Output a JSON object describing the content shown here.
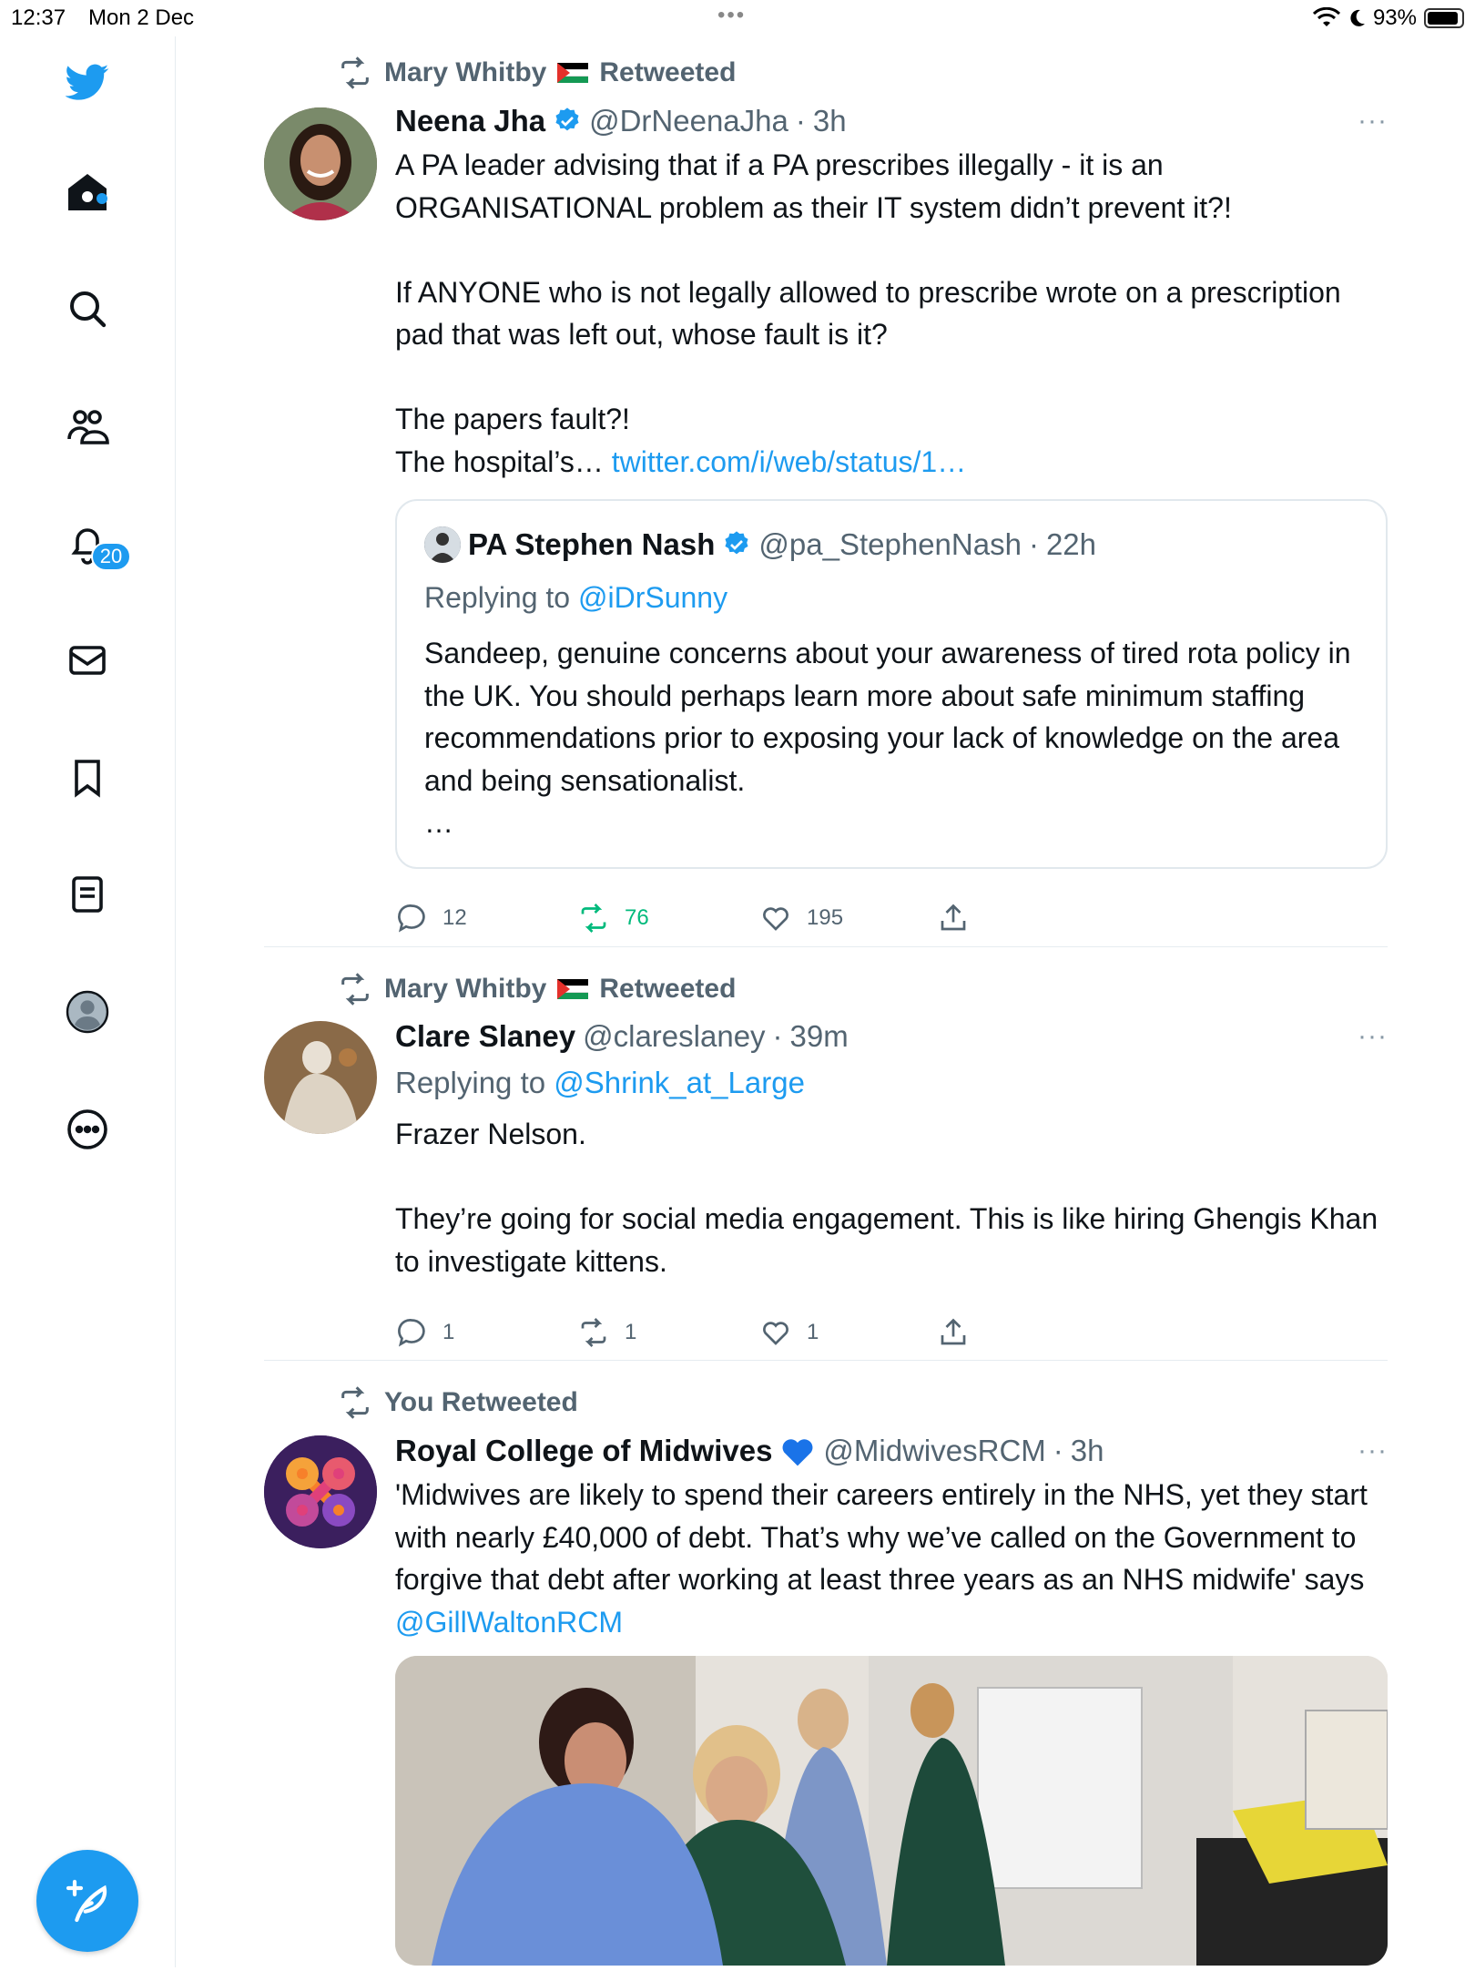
{
  "status_bar": {
    "time": "12:37",
    "date": "Mon 2 Dec",
    "battery": "93%",
    "battery_level": 0.93
  },
  "sidebar": {
    "items": [
      {
        "name": "home"
      },
      {
        "name": "explore"
      },
      {
        "name": "communities"
      },
      {
        "name": "notifications",
        "badge": "20"
      },
      {
        "name": "messages"
      },
      {
        "name": "bookmarks"
      },
      {
        "name": "lists"
      },
      {
        "name": "profile"
      },
      {
        "name": "more"
      }
    ],
    "accent": "#1d9bf0"
  },
  "tweets": [
    {
      "retweeted_by": "Mary Whitby",
      "retweet_label": "Retweeted",
      "name": "Neena Jha",
      "verified": true,
      "handle": "@DrNeenaJha",
      "time": "3h",
      "text": "A PA leader advising that if a PA prescribes illegally - it is an ORGANISATIONAL problem as their IT system didn’t prevent it?!\n\nIf ANYONE who is not legally allowed to prescribe wrote on a prescription pad that was left out, whose fault is it?\n\nThe papers fault?!\nThe hospital’s… ",
      "link": "twitter.com/i/web/status/1…",
      "quote": {
        "name": "PA Stephen Nash",
        "verified": true,
        "handle": "@pa_StephenNash",
        "time": "22h",
        "replying_prefix": "Replying to ",
        "replying_to": "@iDrSunny",
        "text": "Sandeep, genuine concerns about your awareness of tired rota policy in the UK. You should perhaps learn more about safe minimum staffing recommendations prior to exposing your lack of knowledge on the area and being sensationalist.\n…"
      },
      "replies": "12",
      "retweets": "76",
      "likes": "195"
    },
    {
      "retweeted_by": "Mary Whitby",
      "retweet_label": "Retweeted",
      "name": "Clare Slaney",
      "verified": false,
      "handle": "@clareslaney",
      "time": "39m",
      "replying_prefix": "Replying to ",
      "replying_to": "@Shrink_at_Large",
      "text": "Frazer Nelson.\n\nThey’re going for social media engagement. This is like hiring Ghengis Khan to investigate kittens.",
      "replies": "1",
      "retweets": "1",
      "likes": "1"
    },
    {
      "retweeted_by": "You Retweeted",
      "name": "Royal College of Midwives",
      "handle": "@MidwivesRCM",
      "time": "3h",
      "text": "'Midwives are likely to spend their careers entirely in the NHS, yet they start with nearly £40,000 of debt. That’s why we’ve called on the Government to forgive that debt after working at least three years as an NHS midwife' says ",
      "link": "@GillWaltonRCM"
    }
  ],
  "separator": "·",
  "more_glyph": "···"
}
